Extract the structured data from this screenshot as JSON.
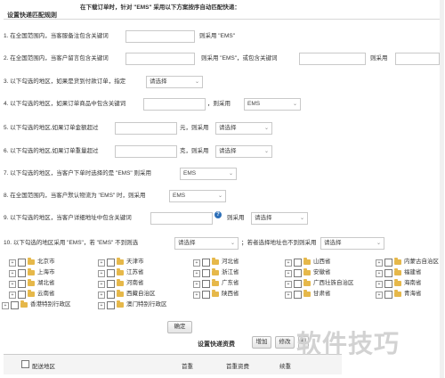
{
  "header": {
    "note": "在下载订单时，针对 \"EMS\" 采用以下方案按序自动匹配快递：",
    "title": "设置快递匹配规则"
  },
  "rules": {
    "r1": {
      "text": "1. 在全国范围内，当客服备注包含关键词",
      "input": "",
      "suffix": "则采用 \"EMS\""
    },
    "r2": {
      "text": "2. 在全国范围内，当客户留言包含关键词",
      "input1": "",
      "mid": "则采用 \"EMS\"，或包含关键词",
      "input2": "",
      "suffix": "则采用",
      "input3": ""
    },
    "r3": {
      "text": "3. 以下勾选的地区，如果是货到付款订单，指定",
      "select": "请选择"
    },
    "r4": {
      "text": "4. 以下勾选的地区，如果订单商品中包含关键词",
      "input": "",
      "suffix": "，则采用",
      "select": "EMS"
    },
    "r5": {
      "text": "5. 以下勾选的地区,如果订单金额超过",
      "input": "",
      "suffix": "元，则采用",
      "select": "请选择"
    },
    "r6": {
      "text": "6. 以下勾选的地区,如果订单重量超过",
      "input": "",
      "suffix": "克，则采用",
      "select": "请选择"
    },
    "r7": {
      "text": "7. 以下勾选的地区，当客户下单时选择的是 \"EMS\" 则采用",
      "select": "EMS"
    },
    "r8": {
      "text": "8. 在全国范围内，当客户默认物流为 \"EMS\" 时，则采用",
      "select": "EMS"
    },
    "r9": {
      "text": "9. 以下勾选的地区，当客户详细地址中包含关键词",
      "input": "",
      "help": "?",
      "suffix": "则采用",
      "select": "请选择"
    },
    "r10": {
      "text": "10. 以下勾选的地区采用 \"EMS\"，若 \"EMS\" 不到则选",
      "select1": "请选择",
      "mid": "；若者选择地址也不到则采用",
      "select2": "请选择"
    }
  },
  "regions": [
    [
      "北京市",
      "天津市",
      "河北省",
      "山西省",
      "内蒙古自治区"
    ],
    [
      "上海市",
      "江苏省",
      "浙江省",
      "安徽省",
      "福建省"
    ],
    [
      "湖北省",
      "河南省",
      "广东省",
      "广西壮族自治区",
      "海南省"
    ],
    [
      "云南省",
      "西藏自治区",
      "陕西省",
      "甘肃省",
      "青海省"
    ],
    [
      "香港特别行政区",
      "澳门特别行政区"
    ]
  ],
  "confirm_label": "确定",
  "delivery": {
    "title": "设置快递资费",
    "add": "增加",
    "edit": "修改",
    "del": "删"
  },
  "table": {
    "cols": [
      "配送地区",
      "首重",
      "首重资费",
      "续重"
    ]
  },
  "watermark": "软件技巧"
}
